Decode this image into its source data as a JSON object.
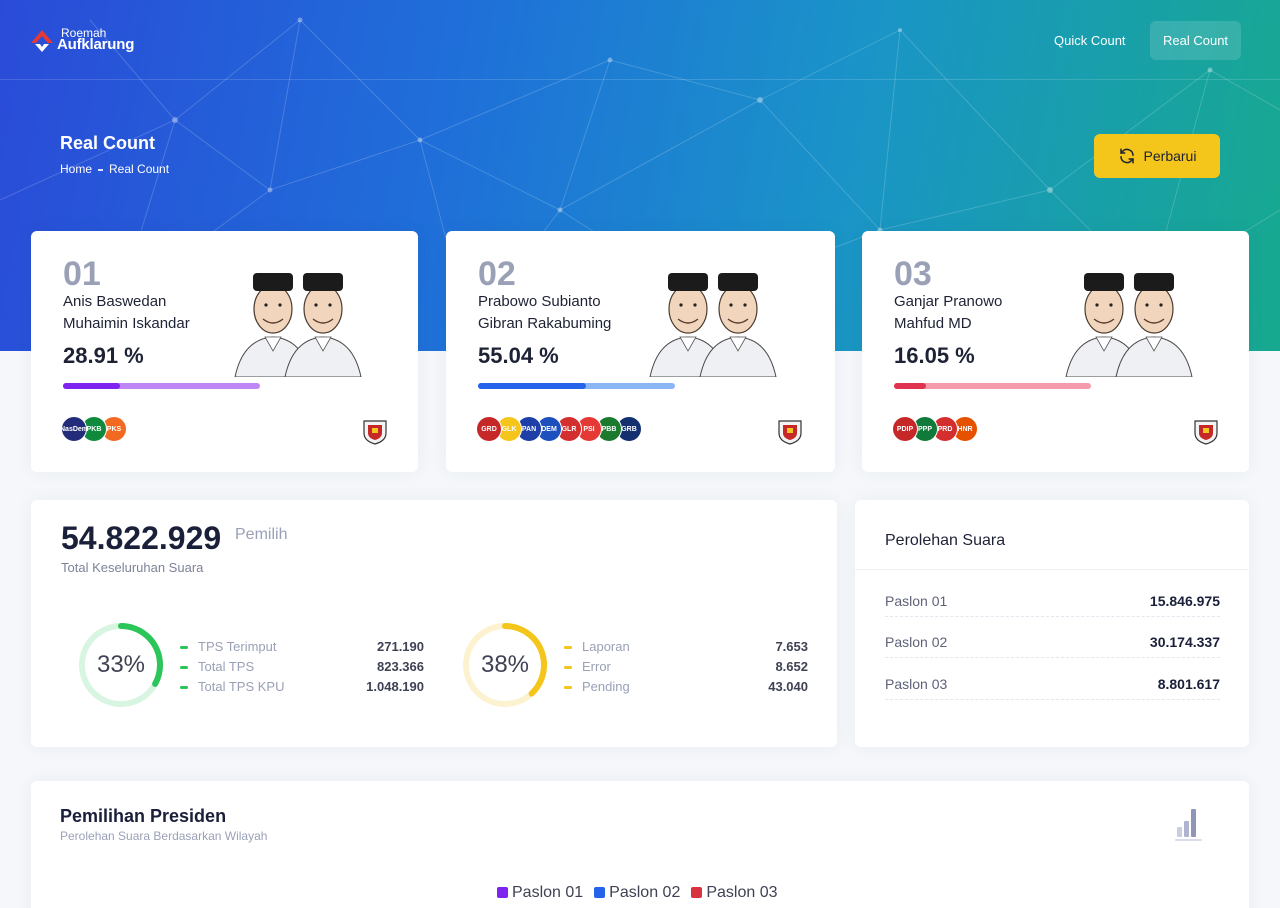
{
  "brand": {
    "line1": "Roemah",
    "line2": "Aufklarung"
  },
  "nav": {
    "quick_count": "Quick Count",
    "real_count": "Real Count"
  },
  "page": {
    "title": "Real Count",
    "breadcrumb": [
      "Home",
      "Real Count"
    ],
    "refresh_label": "Perbarui"
  },
  "colors": {
    "paslon01": "#7e23f0",
    "paslon02": "#2563eb",
    "paslon03": "#e0334f",
    "accent": "#f4c51b"
  },
  "candidates": [
    {
      "number": "01",
      "name1": "Anis Baswedan",
      "name2": "Muhaimin Iskandar",
      "percent": "28.91 %",
      "progress": 0.2891,
      "parties": [
        {
          "label": "NasDem",
          "color": "#232c7a"
        },
        {
          "label": "PKB",
          "color": "#0f8a3c"
        },
        {
          "label": "PKS",
          "color": "#f26a21"
        }
      ]
    },
    {
      "number": "02",
      "name1": "Prabowo Subianto",
      "name2": "Gibran Rakabuming",
      "percent": "55.04 %",
      "progress": 0.5504,
      "parties": [
        {
          "label": "GRD",
          "color": "#c62828"
        },
        {
          "label": "GLK",
          "color": "#f4c51b"
        },
        {
          "label": "PAN",
          "color": "#1e3ea8"
        },
        {
          "label": "DEM",
          "color": "#1d4fbf"
        },
        {
          "label": "GLR",
          "color": "#d32f2f"
        },
        {
          "label": "PSI",
          "color": "#e53935"
        },
        {
          "label": "PBB",
          "color": "#1b7a2e"
        },
        {
          "label": "GRB",
          "color": "#14306e"
        }
      ]
    },
    {
      "number": "03",
      "name1": "Ganjar Pranowo",
      "name2": "Mahfud MD",
      "percent": "16.05 %",
      "progress": 0.1605,
      "parties": [
        {
          "label": "PDIP",
          "color": "#c62828"
        },
        {
          "label": "PPP",
          "color": "#0f7a3a"
        },
        {
          "label": "PRD",
          "color": "#d32f2f"
        },
        {
          "label": "HNR",
          "color": "#e65100"
        }
      ]
    }
  ],
  "summary": {
    "total": "54.822.929",
    "unit": "Pemilih",
    "label": "Total Keseluruhan Suara",
    "tps": {
      "percent": "33%",
      "fraction": 0.33,
      "color": "#2bc559",
      "track": "#d8f5e1",
      "rows": [
        {
          "label": "TPS Terimput",
          "value": "271.190"
        },
        {
          "label": "Total TPS",
          "value": "823.366"
        },
        {
          "label": "Total TPS KPU",
          "value": "1.048.190"
        }
      ]
    },
    "reports": {
      "percent": "38%",
      "fraction": 0.38,
      "color": "#f4c51b",
      "track": "#fdf2cf",
      "rows": [
        {
          "label": "Laporan",
          "value": "7.653"
        },
        {
          "label": "Error",
          "value": "8.652"
        },
        {
          "label": "Pending",
          "value": "43.040"
        }
      ]
    }
  },
  "votes": {
    "title": "Perolehan Suara",
    "rows": [
      {
        "label": "Paslon 01",
        "value": "15.846.975"
      },
      {
        "label": "Paslon 02",
        "value": "30.174.337"
      },
      {
        "label": "Paslon 03",
        "value": "8.801.617"
      }
    ]
  },
  "presidential": {
    "title": "Pemilihan Presiden",
    "subtitle": "Perolehan Suara Berdasarkan Wilayah",
    "legend": [
      {
        "label": "Paslon 01",
        "color": "#7e23f0"
      },
      {
        "label": "Paslon 02",
        "color": "#2563eb"
      },
      {
        "label": "Paslon 03",
        "color": "#d7343f"
      }
    ]
  }
}
